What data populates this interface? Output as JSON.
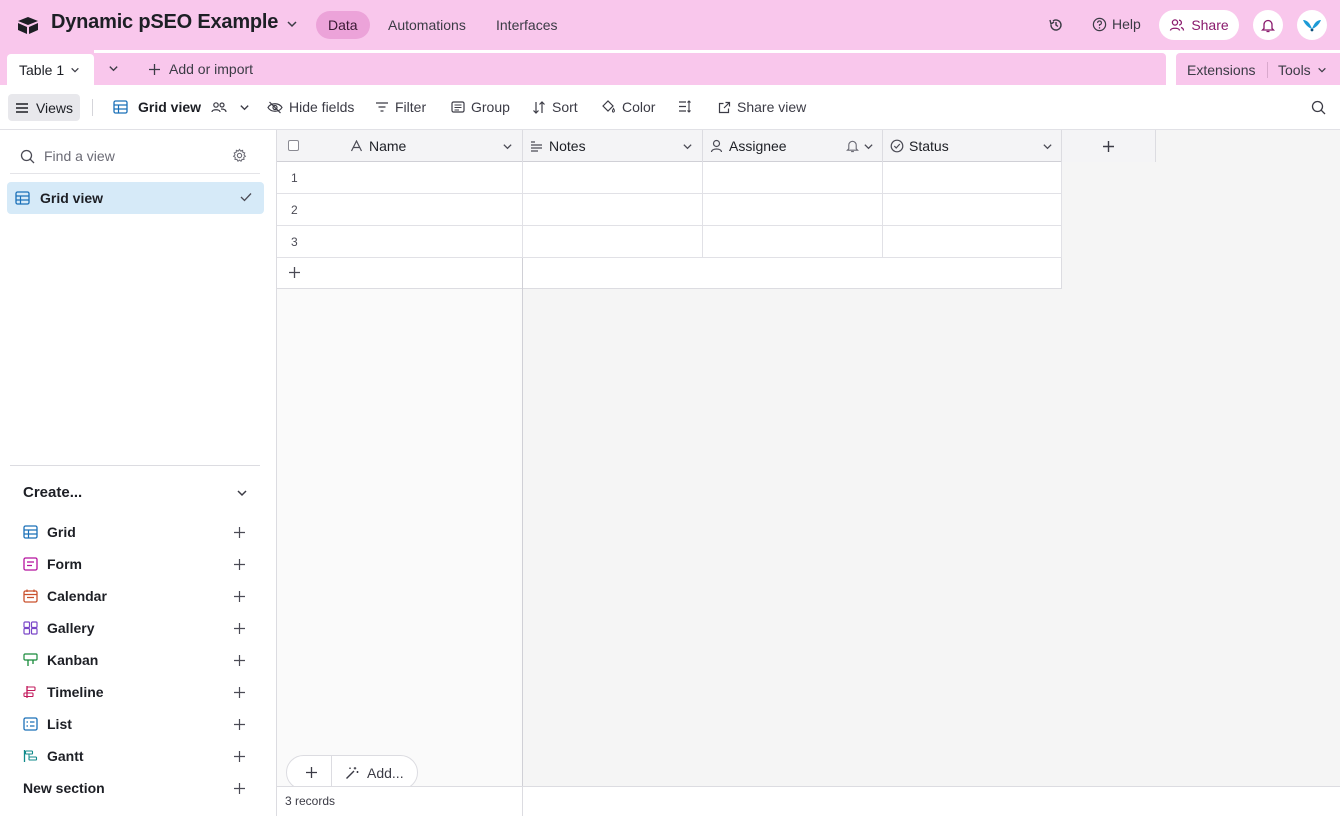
{
  "header": {
    "base_title": "Dynamic pSEO Example",
    "nav_tabs": [
      {
        "label": "Data",
        "active": true
      },
      {
        "label": "Automations",
        "active": false
      },
      {
        "label": "Interfaces",
        "active": false
      }
    ],
    "help_label": "Help",
    "share_label": "Share",
    "brand_color": "#f9c7ec"
  },
  "tablebar": {
    "table_tab": "Table 1",
    "add_import": "Add or import",
    "extensions": "Extensions",
    "tools": "Tools"
  },
  "viewbar": {
    "views_label": "Views",
    "grid_view_label": "Grid view",
    "hide_fields": "Hide fields",
    "filter": "Filter",
    "group": "Group",
    "sort": "Sort",
    "color": "Color",
    "share_view": "Share view"
  },
  "sidebar": {
    "find_placeholder": "Find a view",
    "views": [
      {
        "label": "Grid view",
        "selected": true
      }
    ],
    "create_title": "Create...",
    "create_items": [
      {
        "label": "Grid",
        "icon": "grid-icon",
        "color": "#1b70b8"
      },
      {
        "label": "Form",
        "icon": "form-icon",
        "color": "#b5129e"
      },
      {
        "label": "Calendar",
        "icon": "calendar-icon",
        "color": "#c9502c"
      },
      {
        "label": "Gallery",
        "icon": "gallery-icon",
        "color": "#7a46c8"
      },
      {
        "label": "Kanban",
        "icon": "kanban-icon",
        "color": "#178a3a"
      },
      {
        "label": "Timeline",
        "icon": "timeline-icon",
        "color": "#c2185b"
      },
      {
        "label": "List",
        "icon": "list-icon",
        "color": "#1b70b8"
      },
      {
        "label": "Gantt",
        "icon": "gantt-icon",
        "color": "#0f8a8a"
      }
    ],
    "new_section": "New section"
  },
  "grid": {
    "columns": [
      {
        "label": "Name",
        "icon": "text-field-icon"
      },
      {
        "label": "Notes",
        "icon": "long-text-icon"
      },
      {
        "label": "Assignee",
        "icon": "user-icon"
      },
      {
        "label": "Status",
        "icon": "status-icon"
      }
    ],
    "rows": [
      {
        "num": "1",
        "name": "",
        "notes": "",
        "assignee": "",
        "status": ""
      },
      {
        "num": "2",
        "name": "",
        "notes": "",
        "assignee": "",
        "status": ""
      },
      {
        "num": "3",
        "name": "",
        "notes": "",
        "assignee": "",
        "status": ""
      }
    ],
    "add_label": "Add...",
    "record_count": "3 records"
  }
}
